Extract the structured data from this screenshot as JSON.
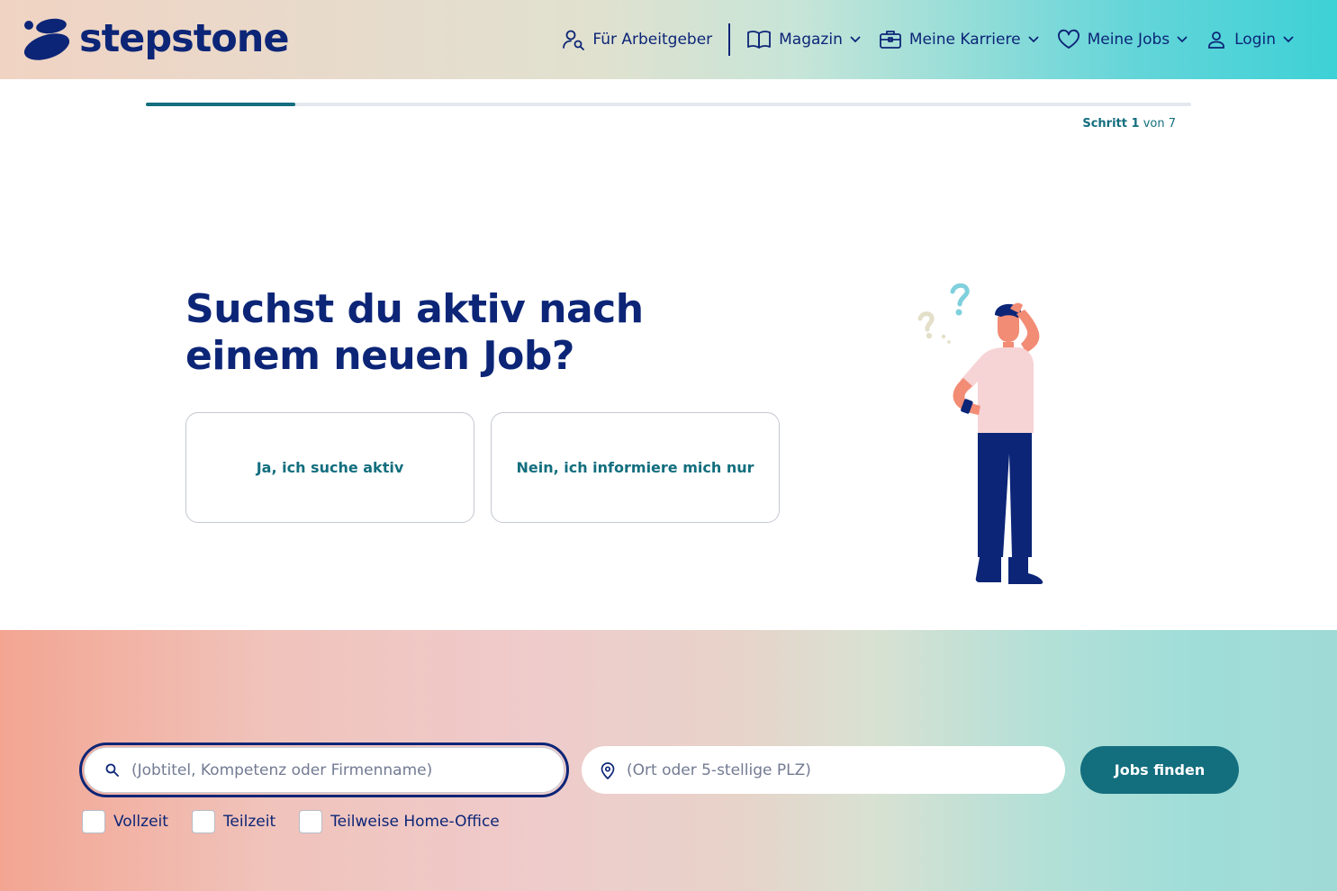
{
  "header": {
    "logo_text": "stepstone",
    "nav": [
      {
        "label": "Für Arbeitgeber"
      },
      {
        "label": "Magazin"
      },
      {
        "label": "Meine Karriere"
      },
      {
        "label": "Meine Jobs"
      },
      {
        "label": "Login"
      }
    ]
  },
  "progress": {
    "step_label": "Schritt 1",
    "of_label": "von 7",
    "current": 1,
    "total": 7
  },
  "question": {
    "title": "Suchst du aktiv nach einem neuen Job?",
    "options": [
      {
        "label": "Ja, ich suche aktiv"
      },
      {
        "label": "Nein, ich informiere mich nur"
      }
    ]
  },
  "search": {
    "keyword_placeholder": "(Jobtitel, Kompetenz oder Firmenname)",
    "location_placeholder": "(Ort oder 5-stellige PLZ)",
    "submit_label": "Jobs finden",
    "filters": [
      {
        "label": "Vollzeit",
        "checked": false
      },
      {
        "label": "Teilzeit",
        "checked": false
      },
      {
        "label": "Teilweise Home-Office",
        "checked": false
      }
    ]
  },
  "colors": {
    "brand_navy": "#0c2577",
    "teal": "#136e7e",
    "illustration_skin": "#f28c75",
    "illustration_shirt": "#f6d4d6",
    "illustration_qmark": "#7fd0dc"
  }
}
